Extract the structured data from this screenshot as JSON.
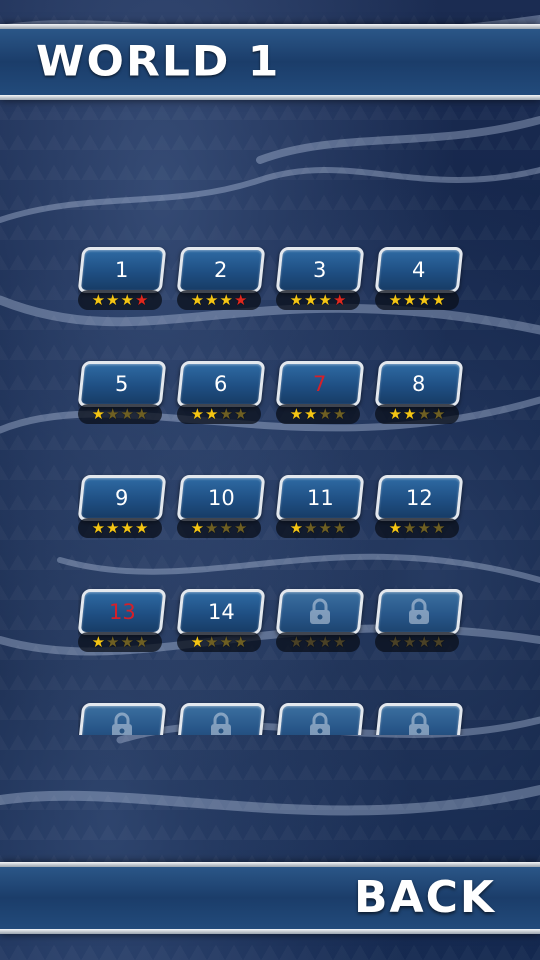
{
  "header": {
    "title": "WORLD 1"
  },
  "footer": {
    "back_label": "BACK"
  },
  "levels": [
    {
      "label": "1",
      "locked": false,
      "red_number": false,
      "stars": [
        "gold",
        "gold",
        "gold",
        "red"
      ]
    },
    {
      "label": "2",
      "locked": false,
      "red_number": false,
      "stars": [
        "gold",
        "gold",
        "gold",
        "red"
      ]
    },
    {
      "label": "3",
      "locked": false,
      "red_number": false,
      "stars": [
        "gold",
        "gold",
        "gold",
        "red"
      ]
    },
    {
      "label": "4",
      "locked": false,
      "red_number": false,
      "stars": [
        "gold",
        "gold",
        "gold",
        "gold"
      ]
    },
    {
      "label": "5",
      "locked": false,
      "red_number": false,
      "stars": [
        "gold",
        "dim",
        "dim",
        "dim"
      ]
    },
    {
      "label": "6",
      "locked": false,
      "red_number": false,
      "stars": [
        "gold",
        "gold",
        "dim",
        "dim"
      ]
    },
    {
      "label": "7",
      "locked": false,
      "red_number": true,
      "stars": [
        "gold",
        "gold",
        "dim",
        "dim"
      ]
    },
    {
      "label": "8",
      "locked": false,
      "red_number": false,
      "stars": [
        "gold",
        "gold",
        "dim",
        "dim"
      ]
    },
    {
      "label": "9",
      "locked": false,
      "red_number": false,
      "stars": [
        "gold",
        "gold",
        "gold",
        "gold"
      ]
    },
    {
      "label": "10",
      "locked": false,
      "red_number": false,
      "stars": [
        "gold",
        "dim",
        "dim",
        "dim"
      ]
    },
    {
      "label": "11",
      "locked": false,
      "red_number": false,
      "stars": [
        "gold",
        "dim",
        "dim",
        "dim"
      ]
    },
    {
      "label": "12",
      "locked": false,
      "red_number": false,
      "stars": [
        "gold",
        "dim",
        "dim",
        "dim"
      ]
    },
    {
      "label": "13",
      "locked": false,
      "red_number": true,
      "stars": [
        "gold",
        "dim",
        "dim",
        "dim"
      ]
    },
    {
      "label": "14",
      "locked": false,
      "red_number": false,
      "stars": [
        "gold",
        "dim",
        "dim",
        "dim"
      ]
    },
    {
      "label": "",
      "locked": true,
      "red_number": false,
      "stars": [
        "locked",
        "locked",
        "locked",
        "locked"
      ]
    },
    {
      "label": "",
      "locked": true,
      "red_number": false,
      "stars": [
        "locked",
        "locked",
        "locked",
        "locked"
      ]
    },
    {
      "label": "",
      "locked": true,
      "red_number": false,
      "stars": []
    },
    {
      "label": "",
      "locked": true,
      "red_number": false,
      "stars": []
    },
    {
      "label": "",
      "locked": true,
      "red_number": false,
      "stars": []
    },
    {
      "label": "",
      "locked": true,
      "red_number": false,
      "stars": []
    }
  ],
  "icons": {
    "star": "star-icon",
    "lock": "padlock-icon"
  },
  "colors": {
    "gold_star": "#f4c514",
    "dim_star": "#6e5f23",
    "red_star": "#e0281e",
    "red_number": "#d4202a",
    "bar": "#1b3d6a"
  }
}
